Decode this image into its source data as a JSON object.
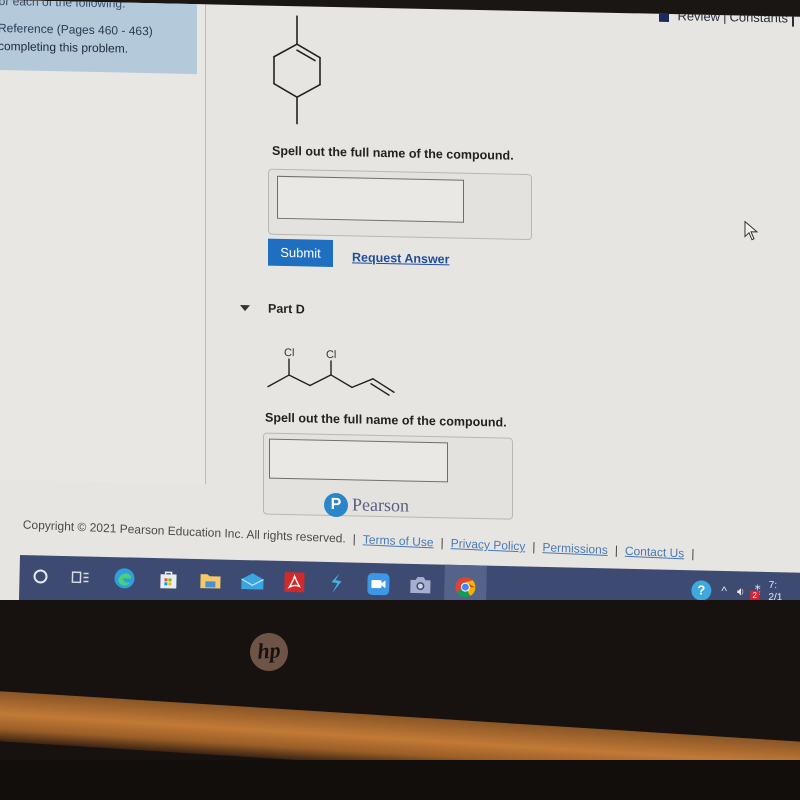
{
  "left_panel": {
    "info_lines": [
      "Name for each of the following.",
      "Reference (Pages 460 - 463)",
      "completing this problem."
    ]
  },
  "topbar": {
    "review_label": "Review",
    "separator": "|",
    "constants_label": "Constants"
  },
  "part_c": {
    "molecule": "1,4-dimethylcyclohexene skeletal structure",
    "prompt": "Spell out the full name of the compound.",
    "answer_value": "",
    "submit_label": "Submit",
    "request_answer_label": "Request Answer"
  },
  "part_d": {
    "title": "Part D",
    "atom_labels": [
      "Cl",
      "Cl"
    ],
    "prompt": "Spell out the full name of the compound.",
    "answer_value": ""
  },
  "brand": {
    "logo_letter": "P",
    "name": "Pearson"
  },
  "footer": {
    "copyright": "Copyright © 2021 Pearson Education Inc. All rights reserved.",
    "links": [
      "Terms of Use",
      "Privacy Policy",
      "Permissions",
      "Contact Us"
    ]
  },
  "taskbar": {
    "apps": [
      {
        "name": "search",
        "icon": "circle-icon"
      },
      {
        "name": "task-view",
        "icon": "task-view-icon"
      },
      {
        "name": "edge",
        "icon": "edge-icon"
      },
      {
        "name": "store",
        "icon": "store-icon"
      },
      {
        "name": "file-explorer",
        "icon": "folder-icon"
      },
      {
        "name": "mail",
        "icon": "mail-icon"
      },
      {
        "name": "acrobat",
        "icon": "pdf-icon"
      },
      {
        "name": "app",
        "icon": "lightning-icon"
      },
      {
        "name": "zoom",
        "icon": "video-icon"
      },
      {
        "name": "camera",
        "icon": "camera-icon"
      },
      {
        "name": "chrome",
        "icon": "chrome-icon"
      }
    ],
    "tray": {
      "badge_count": "2",
      "time_partial": "7:",
      "date_partial": "2/1"
    }
  },
  "device": {
    "logo": "hp"
  }
}
